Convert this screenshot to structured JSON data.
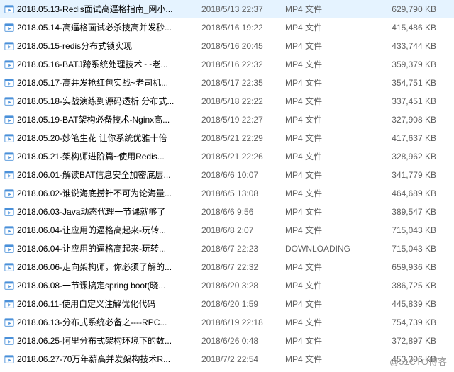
{
  "files": [
    {
      "name": "2018.05.13-Redis面试高逼格指南_网小...",
      "date": "2018/5/13 22:37",
      "type": "MP4 文件",
      "size": "629,790 KB"
    },
    {
      "name": "2018.05.14-高逼格面试必杀技高并发秒...",
      "date": "2018/5/16 19:22",
      "type": "MP4 文件",
      "size": "415,486 KB"
    },
    {
      "name": "2018.05.15-redis分布式锁实现",
      "date": "2018/5/16 20:45",
      "type": "MP4 文件",
      "size": "433,744 KB"
    },
    {
      "name": "2018.05.16-BATJ跨系统处理技术~~老...",
      "date": "2018/5/16 22:32",
      "type": "MP4 文件",
      "size": "359,379 KB"
    },
    {
      "name": "2018.05.17-高并发抢红包实战~老司机...",
      "date": "2018/5/17 22:35",
      "type": "MP4 文件",
      "size": "354,751 KB"
    },
    {
      "name": "2018.05.18-实战演练到源码透析 分布式...",
      "date": "2018/5/18 22:22",
      "type": "MP4 文件",
      "size": "337,451 KB"
    },
    {
      "name": "2018.05.19-BAT架构必备技术-Nginx高...",
      "date": "2018/5/19 22:27",
      "type": "MP4 文件",
      "size": "327,908 KB"
    },
    {
      "name": "2018.05.20-妙笔生花 让你系统优雅十倍",
      "date": "2018/5/21 22:29",
      "type": "MP4 文件",
      "size": "417,637 KB"
    },
    {
      "name": "2018.05.21-架构师进阶篇~使用Redis...",
      "date": "2018/5/21 22:26",
      "type": "MP4 文件",
      "size": "328,962 KB"
    },
    {
      "name": "2018.06.01-解读BAT信息安全加密底层...",
      "date": "2018/6/6 10:07",
      "type": "MP4 文件",
      "size": "341,779 KB"
    },
    {
      "name": "2018.06.02-谁说海底捞针不可为论海量...",
      "date": "2018/6/5 13:08",
      "type": "MP4 文件",
      "size": "464,689 KB"
    },
    {
      "name": "2018.06.03-Java动态代理一节课就够了",
      "date": "2018/6/6 9:56",
      "type": "MP4 文件",
      "size": "389,547 KB"
    },
    {
      "name": "2018.06.04-让应用的逼格高起来-玩转...",
      "date": "2018/6/8 2:07",
      "type": "MP4 文件",
      "size": "715,043 KB"
    },
    {
      "name": "2018.06.04-让应用的逼格高起来-玩转...",
      "date": "2018/6/7 22:23",
      "type": "DOWNLOADING",
      "size": "715,043 KB"
    },
    {
      "name": "2018.06.06-走向架构师，你必须了解的...",
      "date": "2018/6/7 22:32",
      "type": "MP4 文件",
      "size": "659,936 KB"
    },
    {
      "name": "2018.06.08-一节课搞定spring boot(晓...",
      "date": "2018/6/20 3:28",
      "type": "MP4 文件",
      "size": "386,725 KB"
    },
    {
      "name": "2018.06.11-使用自定义注解优化代码",
      "date": "2018/6/20 1:59",
      "type": "MP4 文件",
      "size": "445,839 KB"
    },
    {
      "name": "2018.06.13-分布式系统必备之----RPC...",
      "date": "2018/6/19 22:18",
      "type": "MP4 文件",
      "size": "754,739 KB"
    },
    {
      "name": "2018.06.25-阿里分布式架构环境下的数...",
      "date": "2018/6/26 0:48",
      "type": "MP4 文件",
      "size": "372,897 KB"
    },
    {
      "name": "2018.06.27-70万年薪高并发架构技术R...",
      "date": "2018/7/2 22:54",
      "type": "MP4 文件",
      "size": "453,306 KB"
    }
  ],
  "watermark": "@51CTO博客"
}
